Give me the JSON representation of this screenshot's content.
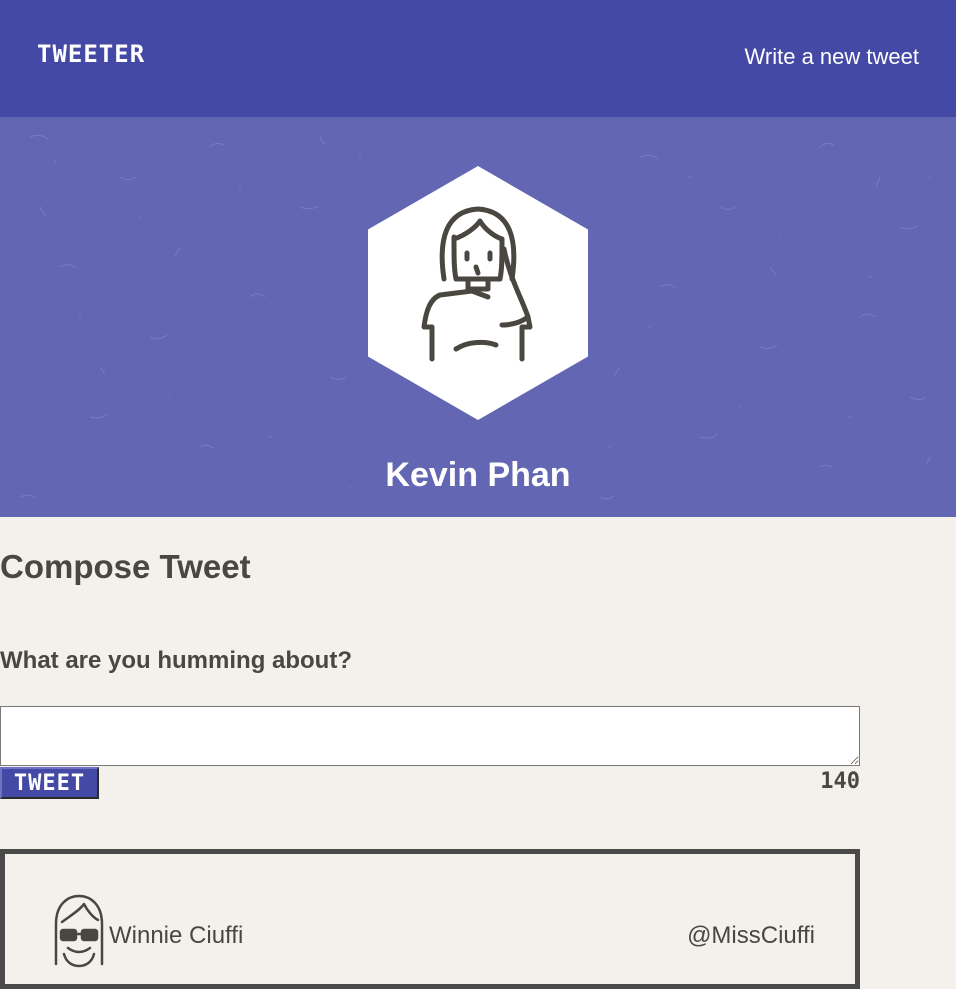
{
  "nav": {
    "brand": "TWEETER",
    "compose_link": "Write a new tweet"
  },
  "profile": {
    "name": "Kevin Phan",
    "avatar_icon": "woman-avatar-icon"
  },
  "compose": {
    "title": "Compose Tweet",
    "label": "What are you humming about?",
    "textarea_value": "",
    "button_label": "TWEET",
    "char_count": "140"
  },
  "tweets": [
    {
      "author": "Winnie Ciuffi",
      "handle": "@MissCiuffi",
      "avatar_icon": "girl-with-glasses-avatar-icon"
    }
  ],
  "colors": {
    "nav_bg": "#4349a4",
    "banner_bg": "#6367b3",
    "page_bg": "#f4f1ec",
    "text": "#4a4740"
  }
}
